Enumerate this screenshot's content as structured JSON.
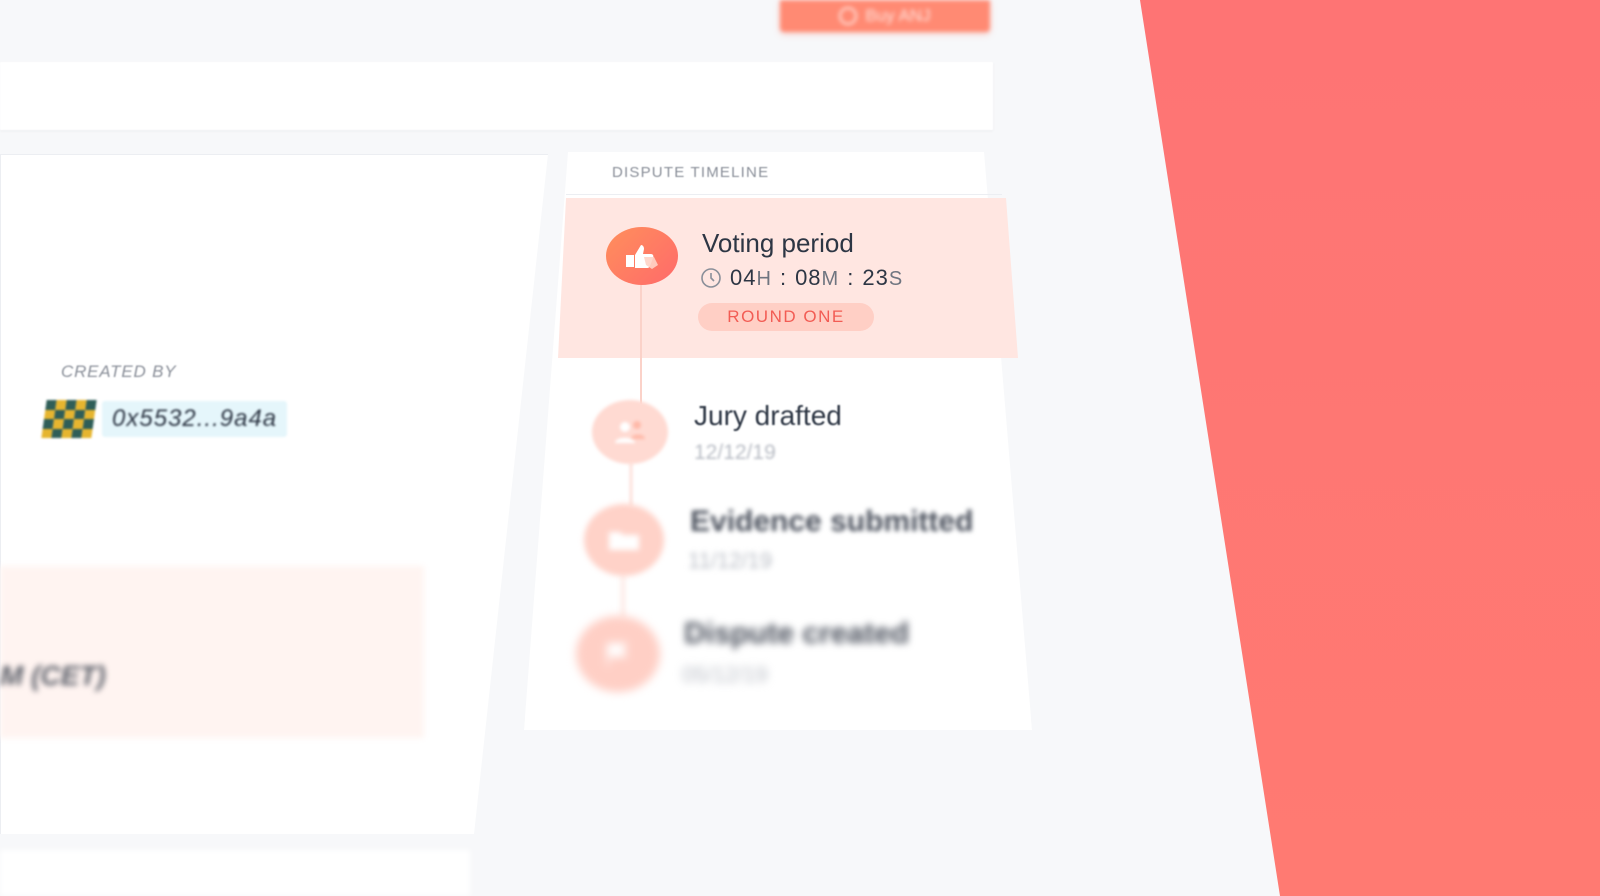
{
  "header": {
    "buy_button_label": "Buy ANJ"
  },
  "dispute": {
    "created_by_label": "CREATED BY",
    "creator_address": "0x5532...9a4a",
    "date_text": "M (CET)"
  },
  "timeline": {
    "title": "DISPUTE TIMELINE",
    "active": {
      "title": "Voting period",
      "timer": {
        "hours": "04",
        "hours_unit": "H",
        "minutes": "08",
        "minutes_unit": "M",
        "seconds": "23",
        "seconds_unit": "S",
        "separator": ":"
      },
      "round_badge": "ROUND ONE"
    },
    "steps": [
      {
        "title": "Jury drafted",
        "date": "12/12/19",
        "icon": "jury-icon"
      },
      {
        "title": "Evidence submitted",
        "date": "11/12/19",
        "icon": "folder-icon"
      },
      {
        "title": "Dispute created",
        "date": "05/12/19",
        "icon": "flag-icon"
      }
    ]
  },
  "colors": {
    "accent": "#ff6a6a",
    "accent_light": "#ffe6e1",
    "coral_panel": "#fe7474",
    "badge_text": "#f25c54"
  }
}
